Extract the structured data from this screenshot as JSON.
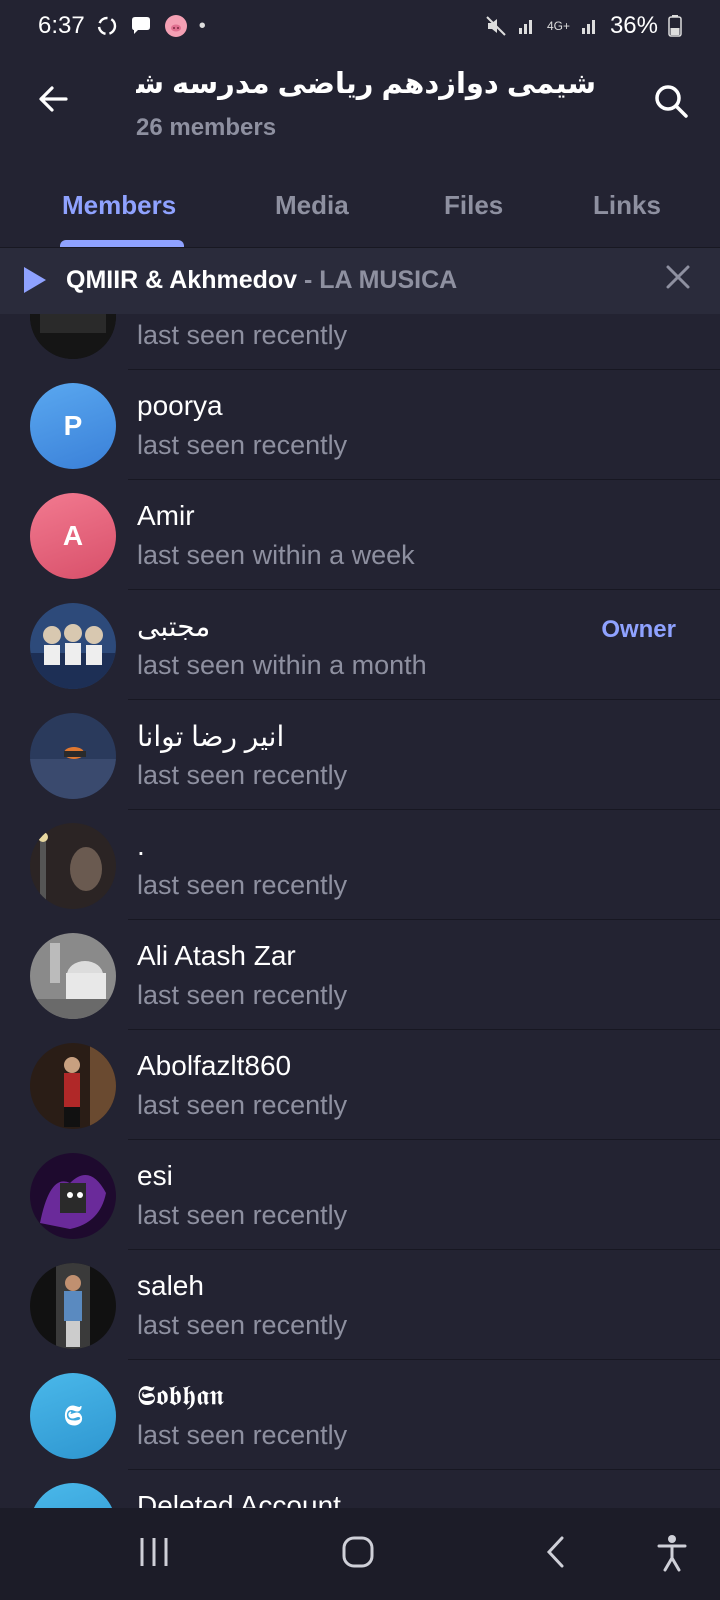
{
  "status_bar": {
    "time": "6:37",
    "notification_icons": [
      "sync-icon",
      "chat-bubble-icon",
      "pig-emoji-icon",
      "dot-icon"
    ],
    "network": "4G+",
    "battery": "36%"
  },
  "header": {
    "title": "شیمی دوازدهم ریاضی مدرسه شاهد",
    "subtitle": "26 members"
  },
  "tabs": [
    {
      "label": "Members",
      "active": true
    },
    {
      "label": "Media",
      "active": false
    },
    {
      "label": "Files",
      "active": false
    },
    {
      "label": "Links",
      "active": false
    }
  ],
  "player": {
    "artist": "QMIIR & Akhmedov",
    "separator": " - ",
    "song": "LA MUSICA"
  },
  "members": [
    {
      "name": "",
      "status": "last seen recently",
      "role": "",
      "initial": "",
      "avatar_color": "#111111"
    },
    {
      "name": "poorya",
      "status": "last seen recently",
      "role": "",
      "initial": "P",
      "avatar_color": "#4a90e2"
    },
    {
      "name": "Amir",
      "status": "last seen within a week",
      "role": "",
      "initial": "A",
      "avatar_color": "#e8637a"
    },
    {
      "name": "مجتبی",
      "status": "last seen within a month",
      "role": "Owner",
      "initial": "",
      "avatar_color": "#3a5a8a"
    },
    {
      "name": "انیر رضا توانا",
      "status": "last seen recently",
      "role": "",
      "initial": "",
      "avatar_color": "#2e3f63"
    },
    {
      "name": ".",
      "status": "last seen recently",
      "role": "",
      "initial": "",
      "avatar_color": "#3a2f2f"
    },
    {
      "name": "Ali Atash Zar",
      "status": "last seen recently",
      "role": "",
      "initial": "",
      "avatar_color": "#9a9a9a"
    },
    {
      "name": "Abolfazlt860",
      "status": "last seen recently",
      "role": "",
      "initial": "",
      "avatar_color": "#2a1d16"
    },
    {
      "name": "esi",
      "status": "last seen recently",
      "role": "",
      "initial": "",
      "avatar_color": "#2a0f3d"
    },
    {
      "name": "saleh",
      "status": "last seen recently",
      "role": "",
      "initial": "",
      "avatar_color": "#2a2a2a"
    },
    {
      "name": "𝕾𝖔𝖇𝖍𝖆𝖓",
      "status": "last seen recently",
      "role": "",
      "initial": "𝕾",
      "avatar_color": "#3aa6dd"
    },
    {
      "name": "Deleted Account",
      "status": "",
      "role": "",
      "initial": "",
      "avatar_color": "#3aa6dd"
    }
  ],
  "nav_icons": [
    "recent-apps-icon",
    "home-icon",
    "back-icon",
    "accessibility-icon"
  ]
}
